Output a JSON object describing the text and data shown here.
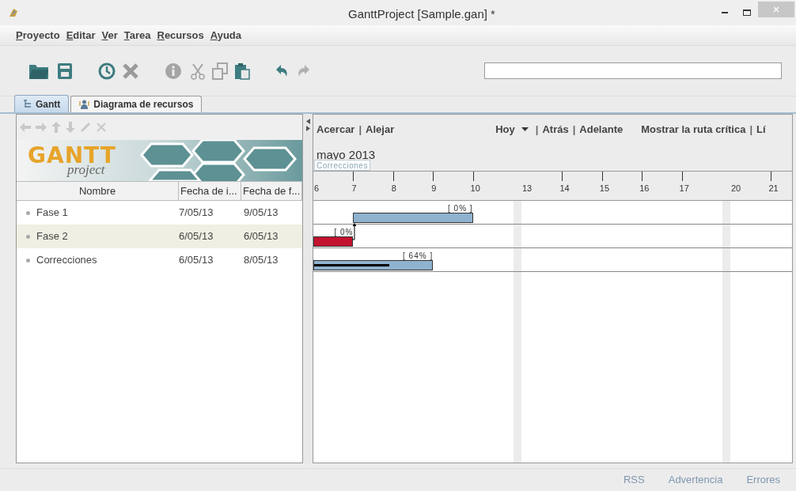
{
  "window": {
    "title": "GanttProject [Sample.gan] *"
  },
  "menu": [
    {
      "label": "Proyecto"
    },
    {
      "label": "Editar"
    },
    {
      "label": "Ver"
    },
    {
      "label": "Tarea"
    },
    {
      "label": "Recursos"
    },
    {
      "label": "Ayuda"
    }
  ],
  "logo": {
    "title": "GANTT",
    "subtitle": "project"
  },
  "tabs": [
    {
      "label": "Gantt",
      "selected": true
    },
    {
      "label": "Diagrama de recursos",
      "selected": false
    }
  ],
  "table": {
    "columns": [
      "Nombre",
      "Fecha de i...",
      "Fecha de f..."
    ],
    "rows": [
      {
        "name": "Fase 1",
        "start": "7/05/13",
        "end": "9/05/13",
        "selected": false
      },
      {
        "name": "Fase 2",
        "start": "6/05/13",
        "end": "6/05/13",
        "selected": true
      },
      {
        "name": "Correcciones",
        "start": "6/05/13",
        "end": "8/05/13",
        "selected": false
      }
    ]
  },
  "chart_toolbar": {
    "left": [
      {
        "kind": "link",
        "label": "Acercar"
      },
      {
        "kind": "sep",
        "label": "|"
      },
      {
        "kind": "link",
        "label": "Alejar"
      }
    ],
    "right": [
      {
        "kind": "dropdown",
        "label": "Hoy"
      },
      {
        "kind": "sep",
        "label": "|"
      },
      {
        "kind": "link",
        "label": "Atrás"
      },
      {
        "kind": "sep",
        "label": "|"
      },
      {
        "kind": "link",
        "label": "Adelante"
      },
      {
        "kind": "gap",
        "label": "Mostrar la ruta crítica"
      },
      {
        "kind": "sep",
        "label": "|"
      },
      {
        "kind": "link",
        "label": "Lí"
      }
    ]
  },
  "timeline": {
    "month": "mayo 2013",
    "hover_label": "Correcciones",
    "days": [
      {
        "label": "6",
        "tick": false
      },
      {
        "label": "7",
        "tick": true
      },
      {
        "label": "8",
        "tick": true
      },
      {
        "label": "9",
        "tick": true
      },
      {
        "label": "10",
        "tick": true
      },
      {
        "label": "13",
        "tick": false
      },
      {
        "label": "14",
        "tick": true
      },
      {
        "label": "15",
        "tick": true
      },
      {
        "label": "16",
        "tick": true
      },
      {
        "label": "17",
        "tick": true
      },
      {
        "label": "20",
        "tick": false
      },
      {
        "label": "21",
        "tick": true
      }
    ]
  },
  "bars": [
    {
      "label": "[ 0% ]",
      "color": "#8fb2cf",
      "arrow_to_row_above": false
    },
    {
      "label": "[ 0%",
      "color": "#c3122e",
      "arrow_to_row_above": true
    },
    {
      "label": "[ 64% ]",
      "level": 0.64,
      "color": "#8fb2cf",
      "arrow_to_row_above": false
    }
  ],
  "status_bar": [
    "RSS",
    "Advertencia",
    "Errores"
  ]
}
